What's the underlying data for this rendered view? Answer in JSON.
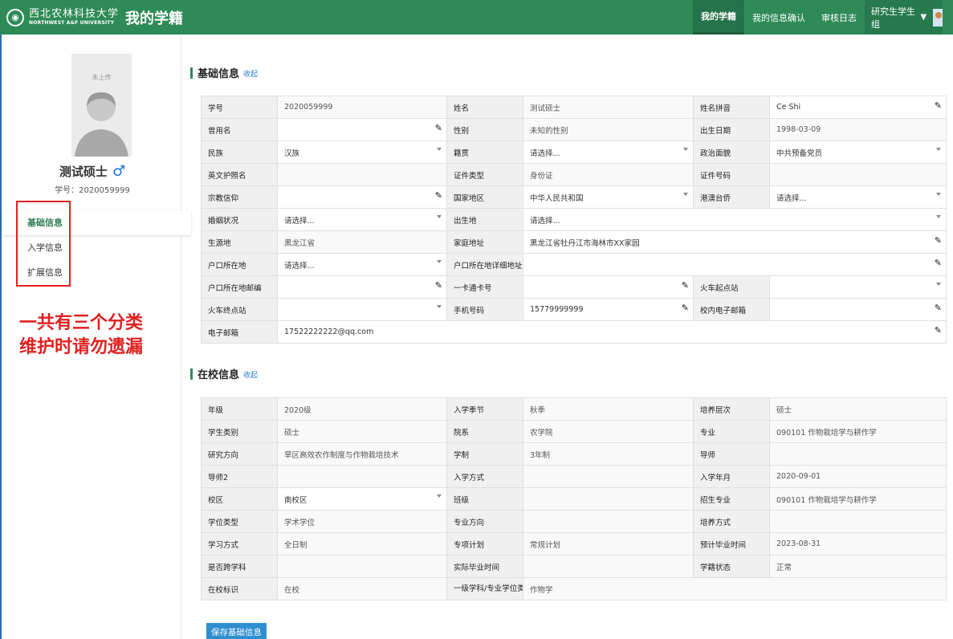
{
  "header": {
    "university_cn": "西北农林科技大学",
    "university_en": "NORTHWEST A&F UNIVERSITY",
    "app_title": "我的学籍",
    "nav": [
      "我的学籍",
      "我的信息确认",
      "审核日志"
    ],
    "user_group": "研究生学生组"
  },
  "sidebar": {
    "photo_note": "未上传",
    "name": "测试硕士",
    "gender_symbol": "♂",
    "student_id": "学号：2020059999",
    "menu": [
      "基础信息",
      "入学信息",
      "扩展信息"
    ],
    "annotation_line1": "一共有三个分类",
    "annotation_line2": "维护时请勿遗漏"
  },
  "basic": {
    "title": "基础信息",
    "collapse": "收起",
    "rows": [
      [
        {
          "l": "学号",
          "v": "2020059999",
          "t": "val"
        },
        {
          "l": "姓名",
          "v": "测试硕士",
          "t": "val"
        },
        {
          "l": "姓名拼音",
          "v": "Ce Shi",
          "t": "pen"
        }
      ],
      [
        {
          "l": "曾用名",
          "v": "",
          "t": "pen"
        },
        {
          "l": "性别",
          "v": "未知的性别",
          "t": "val"
        },
        {
          "l": "出生日期",
          "v": "1998-03-09",
          "t": "val"
        }
      ],
      [
        {
          "l": "民族",
          "v": "汉族",
          "t": "dd"
        },
        {
          "l": "籍贯",
          "v": "请选择...",
          "t": "dd"
        },
        {
          "l": "政治面貌",
          "v": "中共预备党员",
          "t": "dd"
        }
      ],
      [
        {
          "l": "英文护照名",
          "v": "",
          "t": "val"
        },
        {
          "l": "证件类型",
          "v": "身份证",
          "t": "val"
        },
        {
          "l": "证件号码",
          "v": "",
          "t": "val"
        }
      ],
      [
        {
          "l": "宗教信仰",
          "v": "",
          "t": "pen"
        },
        {
          "l": "国家地区",
          "v": "中华人民共和国",
          "t": "dd"
        },
        {
          "l": "港澳台侨",
          "v": "请选择...",
          "t": "dd"
        }
      ],
      [
        {
          "l": "婚姻状况",
          "v": "请选择...",
          "t": "dd"
        },
        {
          "l": "出生地",
          "v": "请选择...",
          "t": "dd",
          "span": 3
        }
      ],
      [
        {
          "l": "生源地",
          "v": "黑龙江省",
          "t": "val"
        },
        {
          "l": "家庭地址",
          "v": "黑龙江省牡丹江市海林市XX家园",
          "t": "pen",
          "span": 3
        }
      ],
      [
        {
          "l": "户口所在地",
          "v": "请选择...",
          "t": "dd"
        },
        {
          "l": "户口所在地详细地址",
          "v": "",
          "t": "pen",
          "span": 3
        }
      ],
      [
        {
          "l": "户口所在地邮编",
          "v": "",
          "t": "pen"
        },
        {
          "l": "一卡通卡号",
          "v": "",
          "t": "pen"
        },
        {
          "l": "火车起点站",
          "v": "",
          "t": "dd"
        }
      ],
      [
        {
          "l": "火车终点站",
          "v": "",
          "t": "dd"
        },
        {
          "l": "手机号码",
          "v": "15779999999",
          "t": "pen"
        },
        {
          "l": "校内电子邮箱",
          "v": "",
          "t": "pen"
        }
      ],
      [
        {
          "l": "电子邮箱",
          "v": "17522222222@qq.com",
          "t": "pen",
          "span": 5
        }
      ]
    ]
  },
  "school": {
    "title": "在校信息",
    "collapse": "收起",
    "rows": [
      [
        {
          "l": "年级",
          "v": "2020级",
          "t": "val"
        },
        {
          "l": "入学季节",
          "v": "秋季",
          "t": "val"
        },
        {
          "l": "培养层次",
          "v": "硕士",
          "t": "val"
        }
      ],
      [
        {
          "l": "学生类别",
          "v": "硕士",
          "t": "val"
        },
        {
          "l": "院系",
          "v": "农学院",
          "t": "val"
        },
        {
          "l": "专业",
          "v": "090101 作物栽培学与耕作学",
          "t": "val"
        }
      ],
      [
        {
          "l": "研究方向",
          "v": "旱区高效农作制度与作物栽培技术",
          "t": "val"
        },
        {
          "l": "学制",
          "v": "3年制",
          "t": "val"
        },
        {
          "l": "导师",
          "v": "",
          "t": "val"
        }
      ],
      [
        {
          "l": "导师2",
          "v": "",
          "t": "val"
        },
        {
          "l": "入学方式",
          "v": "",
          "t": "val"
        },
        {
          "l": "入学年月",
          "v": "2020-09-01",
          "t": "val"
        }
      ],
      [
        {
          "l": "校区",
          "v": "南校区",
          "t": "dd"
        },
        {
          "l": "班级",
          "v": "",
          "t": "val"
        },
        {
          "l": "招生专业",
          "v": "090101 作物栽培学与耕作学",
          "t": "val"
        }
      ],
      [
        {
          "l": "学位类型",
          "v": "学术学位",
          "t": "val"
        },
        {
          "l": "专业方向",
          "v": "",
          "t": "val"
        },
        {
          "l": "培养方式",
          "v": "",
          "t": "val"
        }
      ],
      [
        {
          "l": "学习方式",
          "v": "全日制",
          "t": "val"
        },
        {
          "l": "专项计划",
          "v": "常规计划",
          "t": "val"
        },
        {
          "l": "预计毕业时间",
          "v": "2023-08-31",
          "t": "val"
        }
      ],
      [
        {
          "l": "是否跨学科",
          "v": "",
          "t": "val"
        },
        {
          "l": "实际毕业时间",
          "v": "",
          "t": "val"
        },
        {
          "l": "学籍状态",
          "v": "正常",
          "t": "val"
        }
      ],
      [
        {
          "l": "在校标识",
          "v": "在校",
          "t": "val"
        },
        {
          "l": "一级学科/专业学位类别",
          "v": "作物学",
          "t": "val",
          "span": 3,
          "twoLine": true
        }
      ]
    ]
  },
  "save_button": "保存基础信息",
  "colors": {
    "brand_green": "#2e8b57",
    "link_blue": "#2a7fc9",
    "annotation_red": "#e02020"
  }
}
